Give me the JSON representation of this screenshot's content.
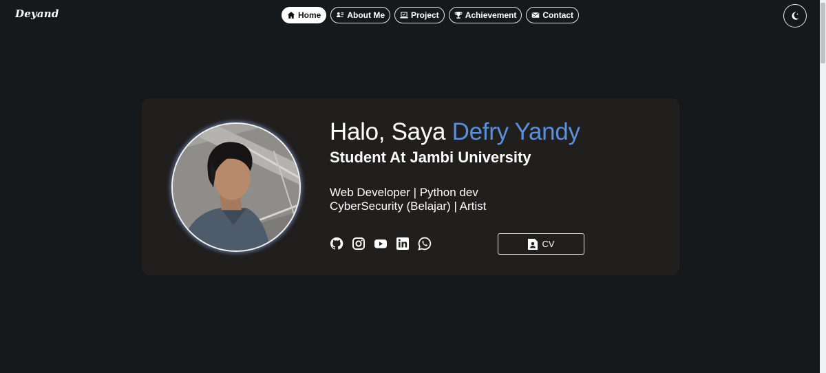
{
  "brand": {
    "logo_text": "Deyand"
  },
  "nav": {
    "items": [
      {
        "label": "Home",
        "icon": "home-icon",
        "active": true
      },
      {
        "label": "About Me",
        "icon": "user-card-icon",
        "active": false
      },
      {
        "label": "Project",
        "icon": "laptop-icon",
        "active": false
      },
      {
        "label": "Achievement",
        "icon": "trophy-icon",
        "active": false
      },
      {
        "label": "Contact",
        "icon": "mail-icon",
        "active": false
      }
    ]
  },
  "theme_toggle": {
    "icon": "moon-icon"
  },
  "hero": {
    "greeting_prefix": "Halo, Saya ",
    "name": "Defry Yandy",
    "subtitle": "Student At Jambi University",
    "roles_line1": "Web Developer | Python dev",
    "roles_line2": "CyberSecurity (Belajar) | Artist",
    "socials": [
      "github-icon",
      "instagram-icon",
      "youtube-icon",
      "linkedin-icon",
      "whatsapp-icon"
    ],
    "cv_label": "CV",
    "cv_icon": "document-user-icon"
  },
  "colors": {
    "background": "#16191c",
    "card": "#211e1e",
    "accent_name": "#5b8fdc",
    "text": "#ffffff"
  }
}
